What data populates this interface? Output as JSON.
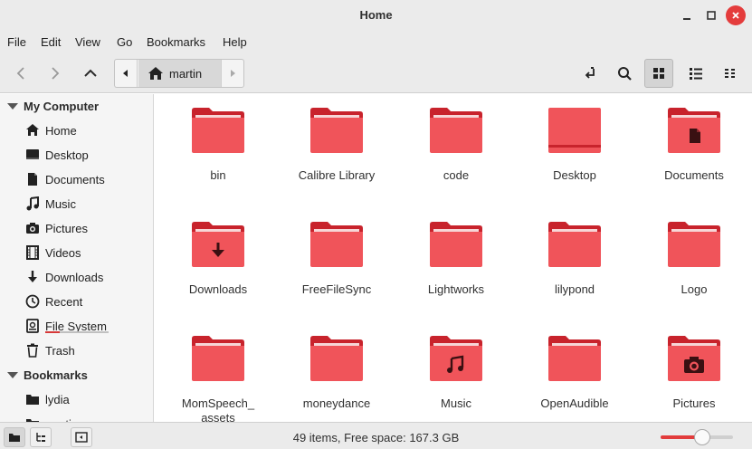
{
  "window": {
    "title": "Home"
  },
  "menu": [
    "File",
    "Edit",
    "View",
    "Go",
    "Bookmarks",
    "Help"
  ],
  "pathbar": {
    "crumb": "martin"
  },
  "sidebar": {
    "my_computer": {
      "heading": "My Computer",
      "items": [
        {
          "label": "Home",
          "icon": "home-icon"
        },
        {
          "label": "Desktop",
          "icon": "desktop-icon"
        },
        {
          "label": "Documents",
          "icon": "document-icon"
        },
        {
          "label": "Music",
          "icon": "music-icon"
        },
        {
          "label": "Pictures",
          "icon": "camera-icon"
        },
        {
          "label": "Videos",
          "icon": "film-icon"
        },
        {
          "label": "Downloads",
          "icon": "download-icon"
        },
        {
          "label": "Recent",
          "icon": "clock-icon"
        },
        {
          "label": "File System",
          "icon": "drive-icon",
          "usage_fraction": 0.23
        },
        {
          "label": "Trash",
          "icon": "trash-icon"
        }
      ]
    },
    "bookmarks": {
      "heading": "Bookmarks",
      "items": [
        {
          "label": "lydia",
          "icon": "folder-icon"
        },
        {
          "label": "martin",
          "icon": "folder-icon"
        }
      ]
    }
  },
  "files": [
    {
      "name": "bin",
      "emblem": ""
    },
    {
      "name": "Calibre Library",
      "emblem": ""
    },
    {
      "name": "code",
      "emblem": ""
    },
    {
      "name": "Desktop",
      "emblem": "desktop"
    },
    {
      "name": "Documents",
      "emblem": "document"
    },
    {
      "name": "Downloads",
      "emblem": "download"
    },
    {
      "name": "FreeFileSync",
      "emblem": ""
    },
    {
      "name": "Lightworks",
      "emblem": ""
    },
    {
      "name": "lilypond",
      "emblem": ""
    },
    {
      "name": "Logo",
      "emblem": ""
    },
    {
      "name": "MomSpeech_\nassets",
      "emblem": ""
    },
    {
      "name": "moneydance",
      "emblem": ""
    },
    {
      "name": "Music",
      "emblem": "music"
    },
    {
      "name": "OpenAudible",
      "emblem": ""
    },
    {
      "name": "Pictures",
      "emblem": "camera"
    }
  ],
  "status": {
    "text": "49 items, Free space: 167.3 GB",
    "zoom_fraction": 0.57
  },
  "colors": {
    "folder": "#f0545a",
    "folder_dark": "#c8232c",
    "accent": "#e23c3c"
  }
}
